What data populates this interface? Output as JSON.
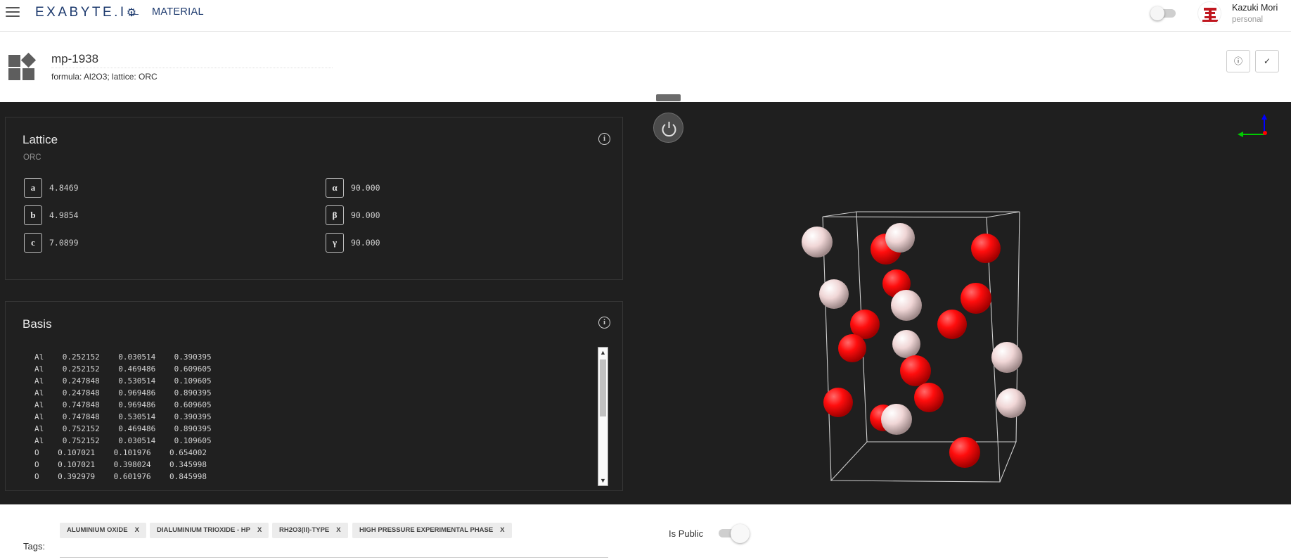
{
  "topbar": {
    "logo": "EXABYTE.I",
    "breadcrumb": "MATERIAL",
    "user_name": "Kazuki Mori",
    "user_account": "personal"
  },
  "material": {
    "name": "mp-1938",
    "subtitle": "formula: Al2O3; lattice: ORC"
  },
  "lattice": {
    "title": "Lattice",
    "type": "ORC",
    "params": [
      {
        "key": "a",
        "value": "4.8469"
      },
      {
        "key": "b",
        "value": "4.9854"
      },
      {
        "key": "c",
        "value": "7.0899"
      },
      {
        "key": "α",
        "value": "90.000"
      },
      {
        "key": "β",
        "value": "90.000"
      },
      {
        "key": "γ",
        "value": "90.000"
      }
    ]
  },
  "basis": {
    "title": "Basis",
    "lines": [
      "Al    0.252152    0.030514    0.390395",
      "Al    0.252152    0.469486    0.609605",
      "Al    0.247848    0.530514    0.109605",
      "Al    0.247848    0.969486    0.890395",
      "Al    0.747848    0.969486    0.609605",
      "Al    0.747848    0.530514    0.390395",
      "Al    0.752152    0.469486    0.890395",
      "Al    0.752152    0.030514    0.109605",
      "O    0.107021    0.101976    0.654002",
      "O    0.107021    0.398024    0.345998",
      "O    0.392979    0.601976    0.845998"
    ]
  },
  "viewer": {
    "atom_colors": {
      "Al": "#f0d6d6",
      "O": "#ff0d0d"
    },
    "axis_colors": {
      "x": "#ff0000",
      "y": "#00cc00",
      "z": "#0000ff"
    }
  },
  "tags": {
    "label": "Tags:",
    "items": [
      "ALUMINIUM OXIDE",
      "DIALUMINIUM TRIOXIDE - HP",
      "RH2O3(II)-TYPE",
      "HIGH PRESSURE EXPERIMENTAL PHASE"
    ],
    "remove_glyph": "X"
  },
  "public": {
    "label": "Is Public",
    "enabled": true
  }
}
